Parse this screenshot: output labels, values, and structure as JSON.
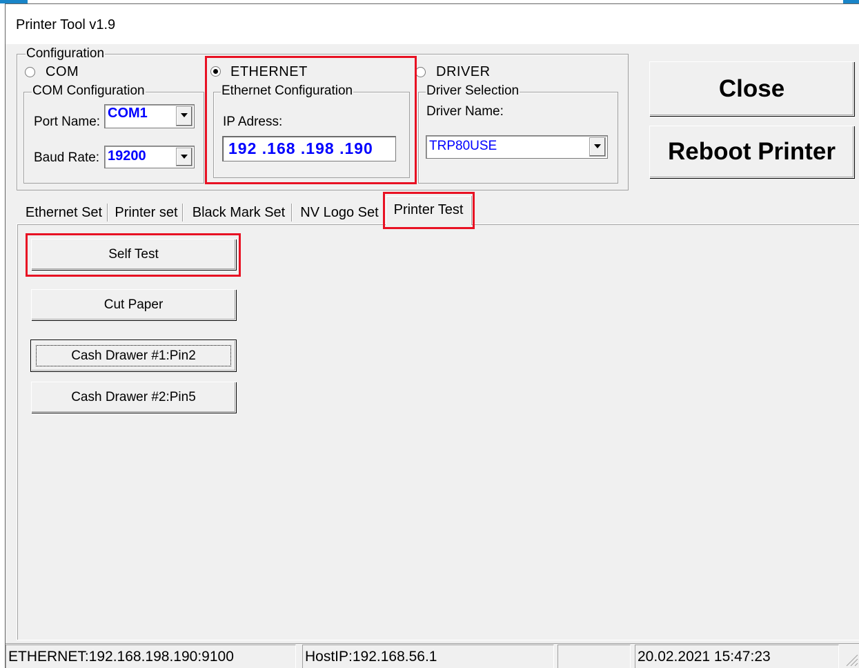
{
  "window": {
    "title": "Printer Tool v1.9"
  },
  "config": {
    "group_label": "Configuration",
    "com": {
      "radio_label": "COM",
      "selected": false,
      "group_label": "COM Configuration",
      "port_label": "Port Name:",
      "port_value": "COM1",
      "baud_label": "Baud Rate:",
      "baud_value": "19200"
    },
    "ethernet": {
      "radio_label": "ETHERNET",
      "selected": true,
      "group_label": "Ethernet Configuration",
      "ip_label": "IP Adress:",
      "ip_value": "192 .168 .198 .190"
    },
    "driver": {
      "radio_label": "DRIVER",
      "selected": false,
      "group_label": "Driver Selection",
      "name_label": "Driver Name:",
      "name_value": "TRP80USE"
    }
  },
  "actions": {
    "close_label": "Close",
    "reboot_label": "Reboot Printer"
  },
  "tabs": [
    {
      "label": "Ethernet Set"
    },
    {
      "label": "Printer set"
    },
    {
      "label": "Black Mark Set"
    },
    {
      "label": "NV Logo Set"
    },
    {
      "label": "Printer Test",
      "active": true
    }
  ],
  "printer_test": {
    "self_test": "Self Test",
    "cut_paper": "Cut Paper",
    "drawer1": "Cash Drawer  #1:Pin2",
    "drawer2": "Cash Drawer  #2:Pin5"
  },
  "statusbar": {
    "connection": "ETHERNET:192.168.198.190:9100",
    "host_ip": "HostIP:192.168.56.1",
    "empty": "",
    "datetime": "20.02.2021 15:47:23"
  },
  "colors": {
    "value_text": "#0000ff",
    "highlight": "#e81123",
    "title_accent": "#1a85c8"
  }
}
